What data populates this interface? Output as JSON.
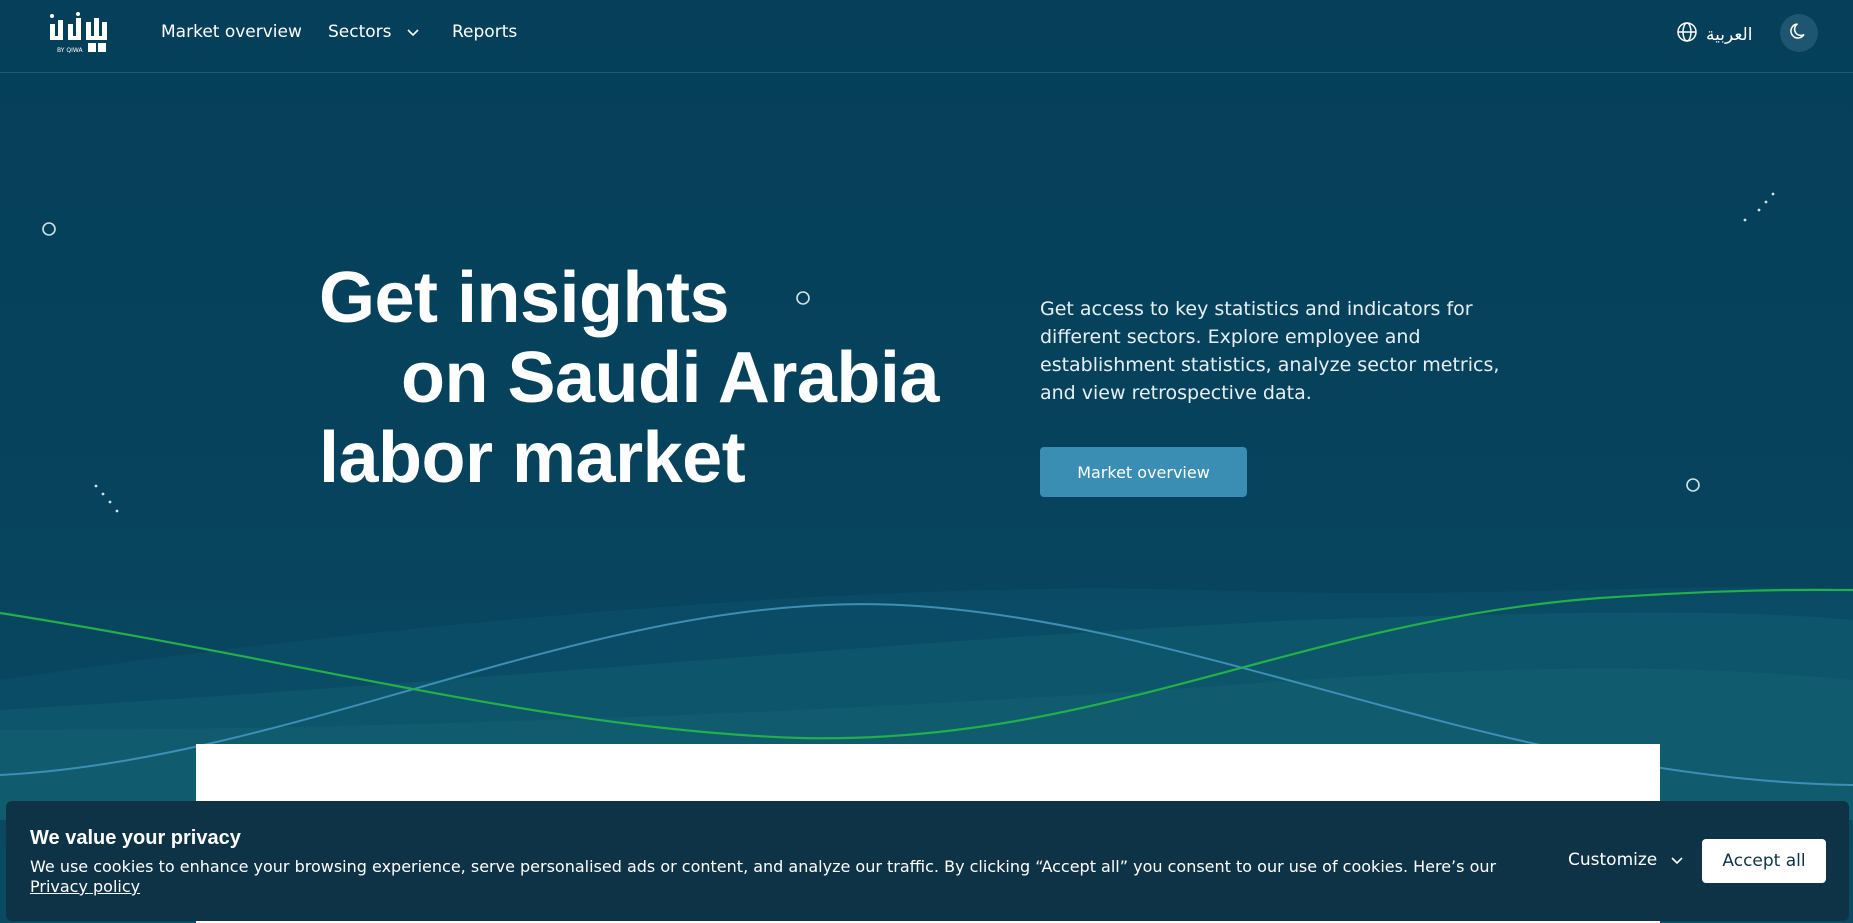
{
  "header": {
    "logo_caption": "BY QIWA",
    "nav": {
      "market_overview": "Market overview",
      "sectors": "Sectors",
      "reports": "Reports"
    },
    "language_label": "العربية",
    "icons": {
      "language": "globe-icon",
      "theme": "moon-icon",
      "sectors_dropdown": "chevron-down-icon"
    }
  },
  "hero": {
    "title_line1": "Get insights",
    "title_line2": "on Saudi Arabia",
    "title_line3": "labor market",
    "description": "Get access to key statistics and indicators for different sectors. Explore employee and establishment statistics, analyze sector metrics, and view retrospective data.",
    "cta_label": "Market overview"
  },
  "colors": {
    "background": "#06405a",
    "accent_button": "#3a8db3",
    "wave_green": "#22b04a",
    "wave_blue": "#3d8fb5",
    "banner": "#0e3346"
  },
  "cookie_banner": {
    "title": "We value your privacy",
    "text": "We use cookies to enhance your browsing experience, serve personalised ads or content, and analyze our traffic. By clicking “Accept all” you consent to our use of cookies. Here’s our ",
    "link_text": "Privacy policy",
    "customize_label": "Customize",
    "accept_label": "Accept all"
  }
}
